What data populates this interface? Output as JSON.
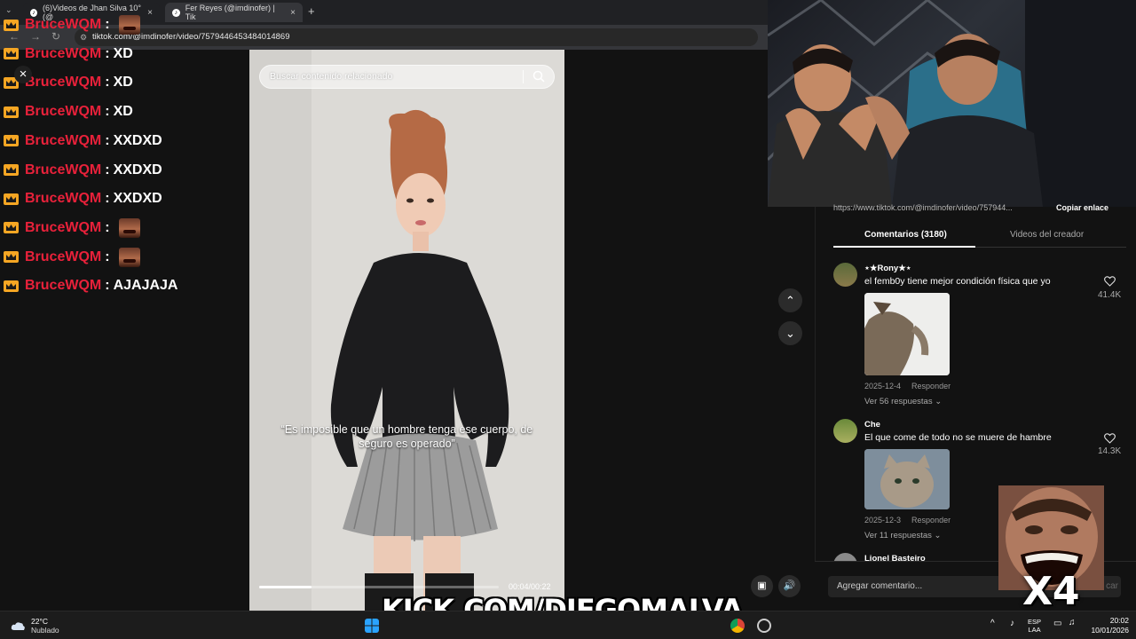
{
  "browser": {
    "tabs": [
      {
        "title": "(6)Videos de Jhan Silva 10° (@",
        "favicon": "tiktok-icon"
      },
      {
        "title": "Fer Reyes (@imdinofer) | Tik",
        "favicon": "tiktok-icon"
      }
    ],
    "new_tab_glyph": "+",
    "url": "tiktok.com/@imdinofer/video/7579446453484014869"
  },
  "chat": {
    "messages": [
      {
        "user": "BruceWQM",
        "text": "",
        "emote": true
      },
      {
        "user": "BruceWQM",
        "text": "XD"
      },
      {
        "user": "BruceWQM",
        "text": "XD"
      },
      {
        "user": "BruceWQM",
        "text": "XD"
      },
      {
        "user": "BruceWQM",
        "text": "XXDXD"
      },
      {
        "user": "BruceWQM",
        "text": "XXDXD"
      },
      {
        "user": "BruceWQM",
        "text": "XXDXD"
      },
      {
        "user": "BruceWQM",
        "text": "",
        "emote": true
      },
      {
        "user": "BruceWQM",
        "text": "",
        "emote": true
      },
      {
        "user": "BruceWQM",
        "text": "AJAJAJA"
      }
    ],
    "separator": ":"
  },
  "video": {
    "search_placeholder": "Buscar contenido relacionado",
    "caption": "“Es imposible que un hombre tenga ese cuerpo, de seguro es operado”",
    "time": "00:04/00:22",
    "progress": 0.22
  },
  "panel": {
    "share_link": "https://www.tiktok.com/@imdinofer/video/757944...",
    "copy_link_label": "Copiar enlace",
    "tabs": {
      "comments": "Comentarios (3180)",
      "creator_videos": "Videos del creador"
    },
    "comments": [
      {
        "user": "⋆★Rony★⋆",
        "text": "el femb0y tiene mejor condición física que yo",
        "date": "2025-12-4",
        "reply_label": "Responder",
        "replies": "Ver 56 respuestas",
        "likes": "41.4K"
      },
      {
        "user": "Che",
        "text": "El que come de todo no se muere de hambre",
        "date": "2025-12-3",
        "reply_label": "Responder",
        "replies": "Ver 11 respuestas",
        "likes": "14.3K"
      },
      {
        "user": "Lionel Basteiro"
      }
    ],
    "add_comment_placeholder": "Agregar comentario...",
    "post_label": "Publicar",
    "post_label_visible": "car"
  },
  "overlay": {
    "channel": "KICK.COM/DIEGOMALVA",
    "multiplier": "X4"
  },
  "taskbar": {
    "temperature": "22°C",
    "condition": "Nublado",
    "lang_top": "ESP",
    "lang_bottom": "LAA",
    "time": "20:02",
    "date": "10/01/2026"
  },
  "colors": {
    "chat_username": "#e8213a",
    "crown": "#f5a623",
    "background": "#121212"
  }
}
